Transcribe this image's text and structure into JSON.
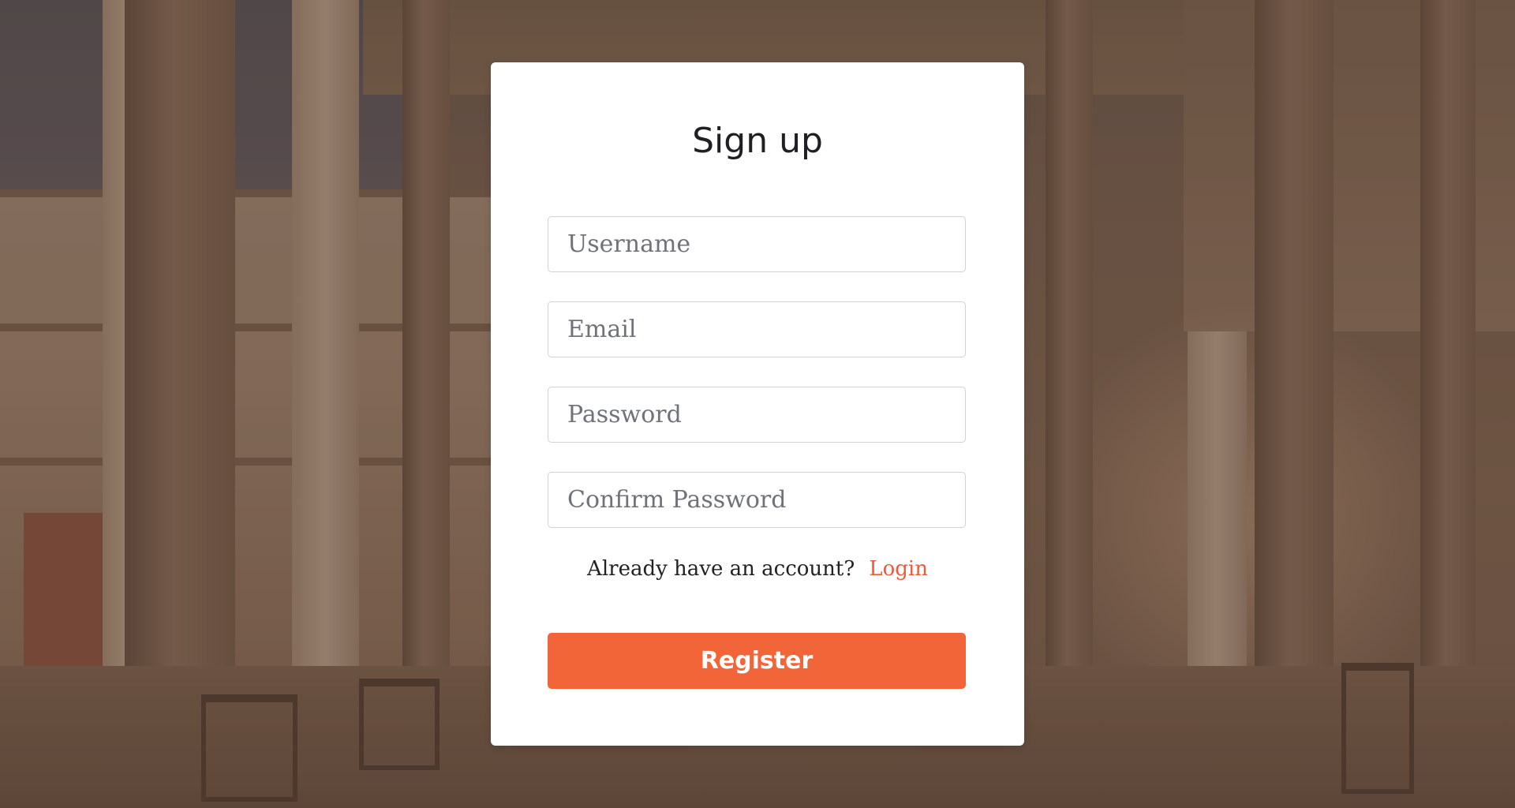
{
  "form": {
    "title": "Sign up",
    "username_placeholder": "Username",
    "email_placeholder": "Email",
    "password_placeholder": "Password",
    "confirm_password_placeholder": "Confirm Password",
    "account_prompt": "Already have an account?",
    "login_link": "Login",
    "register_label": "Register"
  },
  "colors": {
    "accent": "#f26539",
    "link": "#ec5a3c",
    "card_background": "#ffffff",
    "backdrop_tint": "#5e4b3e"
  }
}
